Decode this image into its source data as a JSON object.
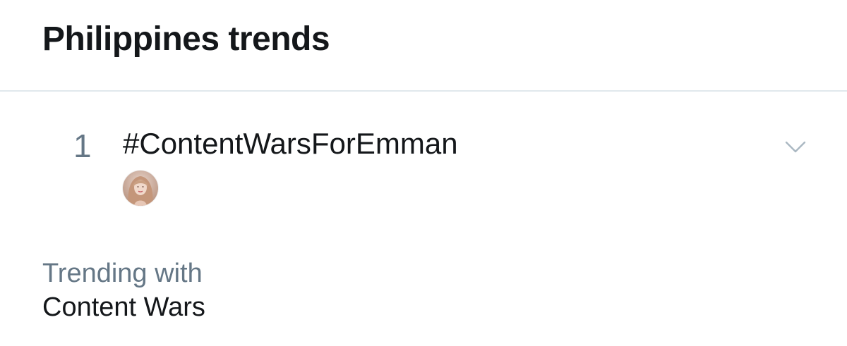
{
  "header": {
    "title": "Philippines trends"
  },
  "trend": {
    "rank": "1",
    "name": "#ContentWarsForEmman",
    "avatar_icon": "user-avatar-icon",
    "menu_icon": "chevron-down-icon"
  },
  "trending_with": {
    "label": "Trending with",
    "items": [
      "Content Wars"
    ]
  },
  "colors": {
    "primary_text": "#14171a",
    "secondary_text": "#657786",
    "divider": "#e1e8ed",
    "chevron": "#aab8c2"
  }
}
